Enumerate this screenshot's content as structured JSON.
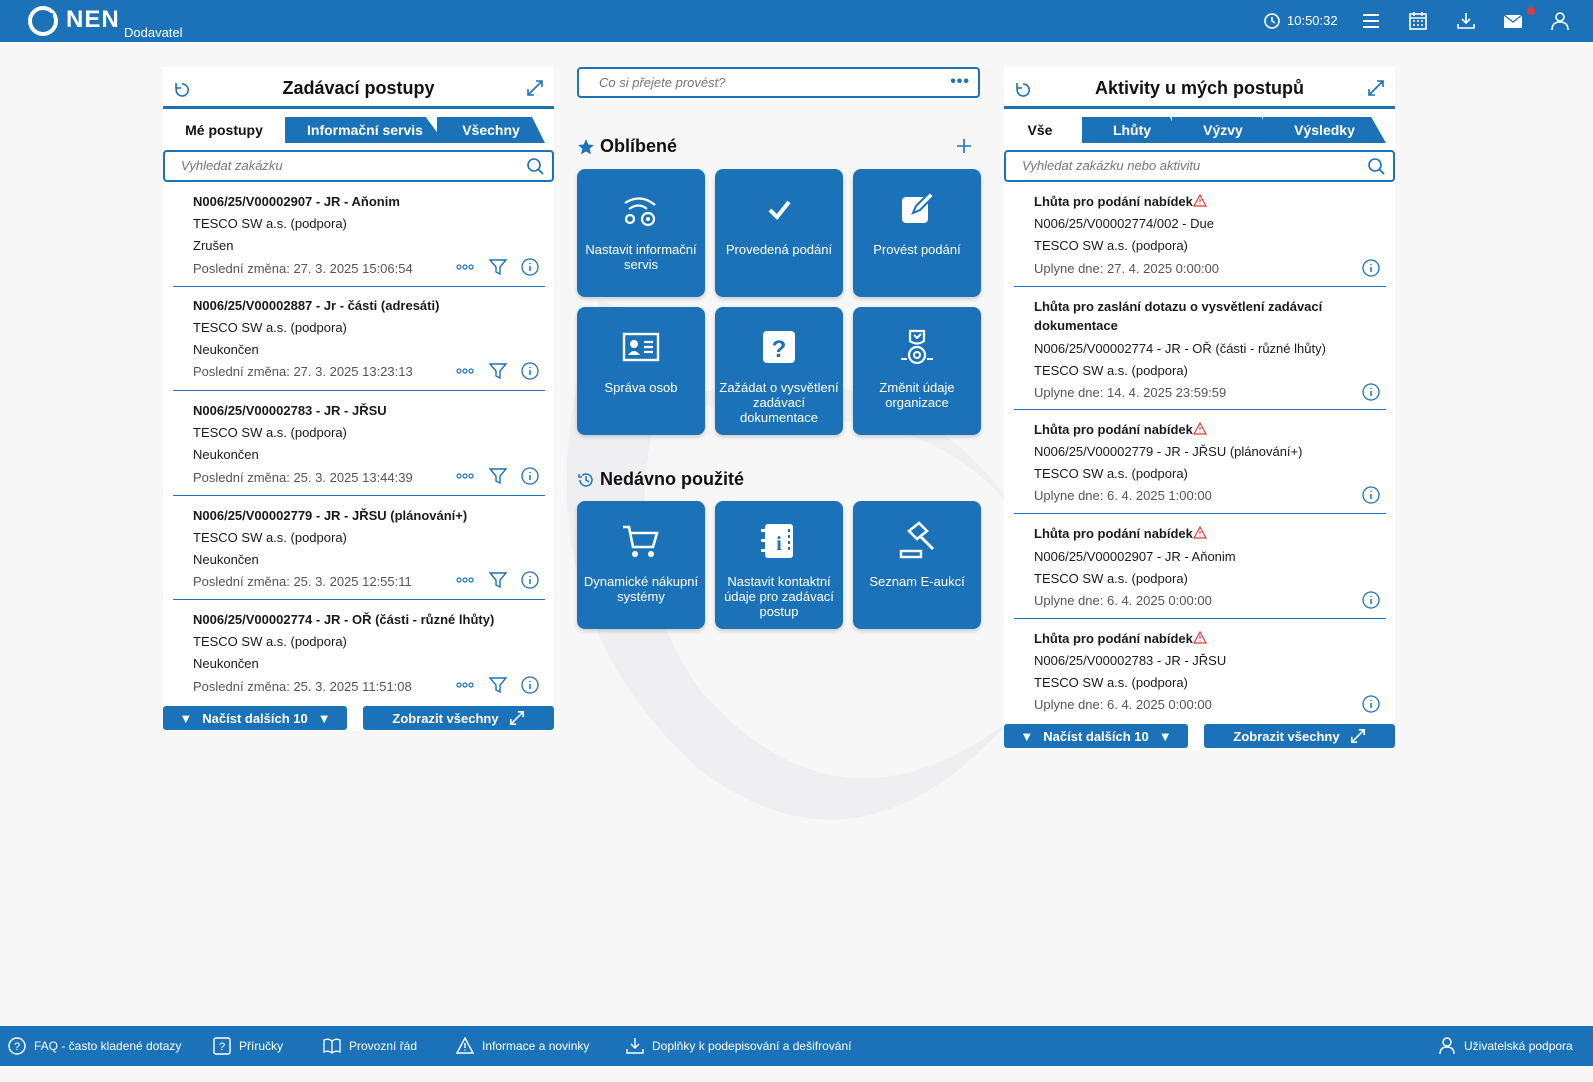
{
  "header": {
    "logo_text": "NEN",
    "logo_sub": "Dodavatel",
    "time": "10:50:32"
  },
  "left_panel": {
    "title": "Zadávací postupy",
    "tabs": [
      "Mé postupy",
      "Informační servis",
      "Všechny"
    ],
    "search_placeholder": "Vyhledat zakázku",
    "items": [
      {
        "code": "N006/25/V00002907 - JR - Aňonim",
        "org": "TESCO SW a.s. (podpora)",
        "status": "Zrušen",
        "changed": "Poslední změna: 27. 3. 2025 15:06:54"
      },
      {
        "code": "N006/25/V00002887 - Jr - části (adresáti)",
        "org": "TESCO SW a.s. (podpora)",
        "status": "Neukončen",
        "changed": "Poslední změna: 27. 3. 2025 13:23:13"
      },
      {
        "code": "N006/25/V00002783 - JR - JŘSU",
        "org": "TESCO SW a.s. (podpora)",
        "status": "Neukončen",
        "changed": "Poslední změna: 25. 3. 2025 13:44:39"
      },
      {
        "code": "N006/25/V00002779 - JR - JŘSU (plánování+)",
        "org": "TESCO SW a.s. (podpora)",
        "status": "Neukončen",
        "changed": "Poslední změna: 25. 3. 2025 12:55:11"
      },
      {
        "code": "N006/25/V00002774 - JR - OŘ (části - různé lhůty)",
        "org": "TESCO SW a.s. (podpora)",
        "status": "Neukončen",
        "changed": "Poslední změna: 25. 3. 2025 11:51:08"
      }
    ],
    "load_more": "Načíst dalších 10",
    "show_all": "Zobrazit všechny"
  },
  "center": {
    "search_placeholder": "Co si přejete provést?",
    "favorites_title": "Oblíbené",
    "favorites": [
      "Nastavit informační servis",
      "Provedená podání",
      "Provést podání",
      "Správa osob",
      "Zažádat o vysvětlení zadávací dokumentace",
      "Změnit údaje organizace"
    ],
    "recent_title": "Nedávno použité",
    "recent": [
      "Dynamické nákupní systémy",
      "Nastavit kontaktní údaje pro zadávací postup",
      "Seznam E-aukcí"
    ]
  },
  "right_panel": {
    "title": "Aktivity u mých postupů",
    "tabs": [
      "Vše",
      "Lhůty",
      "Výzvy",
      "Výsledky"
    ],
    "search_placeholder": "Vyhledat zakázku nebo aktivitu",
    "items": [
      {
        "title": "Lhůta pro podání nabídek",
        "code": "N006/25/V00002774/002 - Due",
        "org": "TESCO SW a.s. (podpora)",
        "due": "Uplyne dne: 27. 4. 2025 0:00:00"
      },
      {
        "title": "Lhůta pro zaslání dotazu o vysvětlení zadávací",
        "title2": "dokumentace",
        "code": "N006/25/V00002774 - JR - OŘ (části - různé lhůty)",
        "org": "TESCO SW a.s. (podpora)",
        "due": "Uplyne dne: 14. 4. 2025 23:59:59"
      },
      {
        "title": "Lhůta pro podání nabídek",
        "code": "N006/25/V00002779 - JR - JŘSU (plánování+)",
        "org": "TESCO SW a.s. (podpora)",
        "due": "Uplyne dne: 6. 4. 2025 1:00:00"
      },
      {
        "title": "Lhůta pro podání nabídek",
        "code": "N006/25/V00002907 - JR - Aňonim",
        "org": "TESCO SW a.s. (podpora)",
        "due": "Uplyne dne: 6. 4. 2025 0:00:00"
      },
      {
        "title": "Lhůta pro podání nabídek",
        "code": "N006/25/V00002783 - JR - JŘSU",
        "org": "TESCO SW a.s. (podpora)",
        "due": "Uplyne dne: 6. 4. 2025 0:00:00"
      }
    ],
    "load_more": "Načíst dalších 10",
    "show_all": "Zobrazit všechny"
  },
  "footer": {
    "faq": "FAQ - často kladené dotazy",
    "manuals": "Příručky",
    "rules": "Provozní řád",
    "news": "Informace a novinky",
    "addons": "Doplňky k podepisování a dešifrování",
    "support": "Uživatelská podpora"
  },
  "colors": {
    "primary": "#1b72b9",
    "warning": "#e53935"
  }
}
